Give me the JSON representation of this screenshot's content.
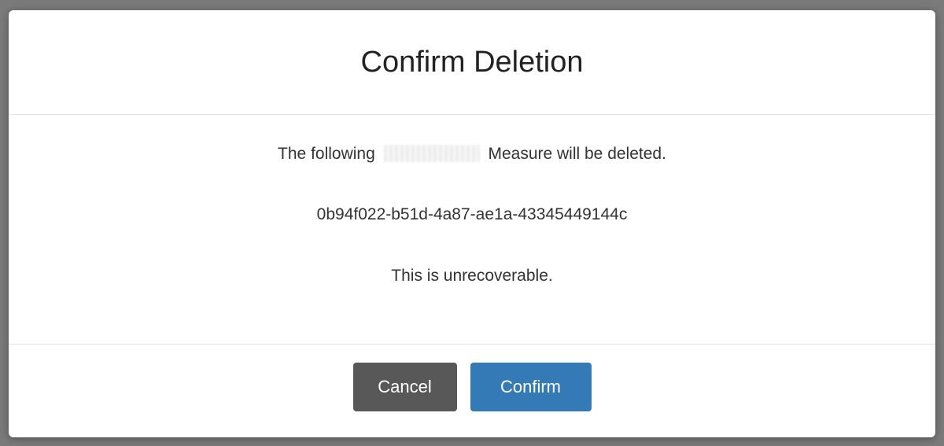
{
  "dialog": {
    "title": "Confirm Deletion",
    "message_prefix": "The following",
    "message_suffix": "Measure will be deleted.",
    "record_id": "0b94f022-b51d-4a87-ae1a-43345449144c",
    "warning": "This is unrecoverable."
  },
  "buttons": {
    "cancel_label": "Cancel",
    "confirm_label": "Confirm"
  },
  "colors": {
    "confirm_button": "#337ab7",
    "cancel_button": "#585858",
    "overlay": "#7a7a7a"
  }
}
